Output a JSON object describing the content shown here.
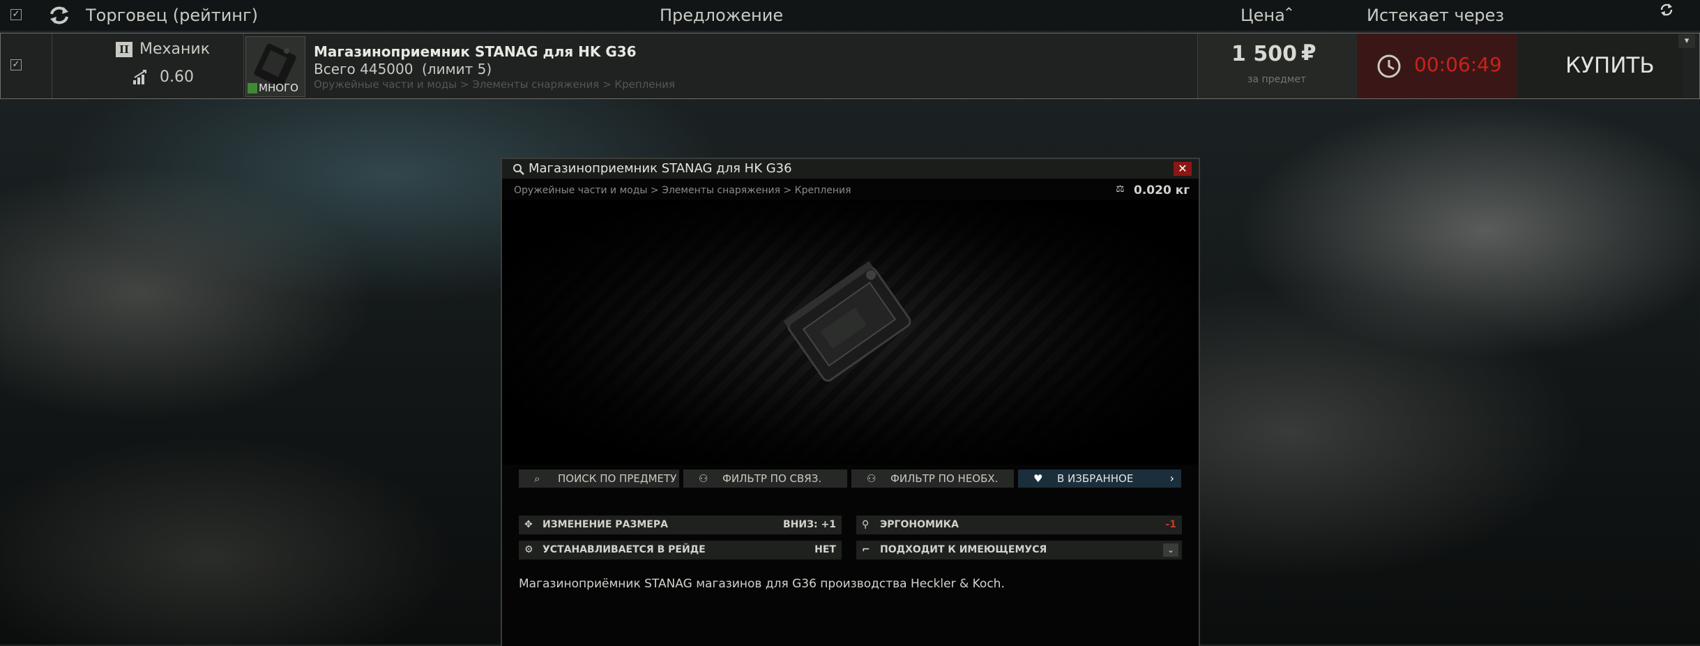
{
  "header": {
    "trader_col": "Торговец (рейтинг)",
    "offer_col": "Предложение",
    "price_col": "Цена",
    "price_sort_icon": "chevron-up-icon",
    "expires_col": "Истекает через"
  },
  "offer": {
    "trader_rank": "II",
    "trader_name": "Механик",
    "rating": "0.60",
    "item_name": "Магазиноприемник STANAG для HK G36",
    "total": "Всего 445000",
    "limit": "(лимит 5)",
    "category": "Оружейные части и моды > Элементы снаряжения > Крепления",
    "stock_badge": "МНОГО",
    "price": "1 500",
    "currency": "₽",
    "price_unit": "за предмет",
    "timer": "00:06:49",
    "buy_label": "КУПИТЬ"
  },
  "inspect": {
    "search_title": "Магазиноприемник STANAG для HK G36",
    "breadcrumb": "Оружейные части и моды > Элементы снаряжения > Крепления",
    "weight": "0.020 кг",
    "actions": [
      {
        "label": "ПОИСК ПО ПРЕДМЕТУ",
        "icon": "magnifier-icon"
      },
      {
        "label": "ФИЛЬТР ПО СВЯЗ.",
        "icon": "link-tree-icon"
      },
      {
        "label": "ФИЛЬТР ПО НЕОБХ.",
        "icon": "link-tree-icon"
      },
      {
        "label": "В ИЗБРАННОЕ",
        "icon": "heart-icon"
      }
    ],
    "stats": {
      "size_label": "ИЗМЕНЕНИЕ РАЗМЕРА",
      "size_value": "ВНИЗ: +1",
      "ergo_label": "ЭРГОНОМИКА",
      "ergo_value": "-1",
      "raid_label": "УСТАНАВЛИВАЕТСЯ В РЕЙДЕ",
      "raid_value": "НЕТ",
      "fits_label": "ПОДХОДИТ К ИМЕЮЩЕМУСЯ"
    },
    "description": "Магазиноприёмник STANAG магазинов для G36 производства Heckler & Koch."
  },
  "colors": {
    "timer_red": "#c8221c",
    "favorite_blue": "#1b2e3c",
    "ergo_red": "#c33a2a"
  }
}
